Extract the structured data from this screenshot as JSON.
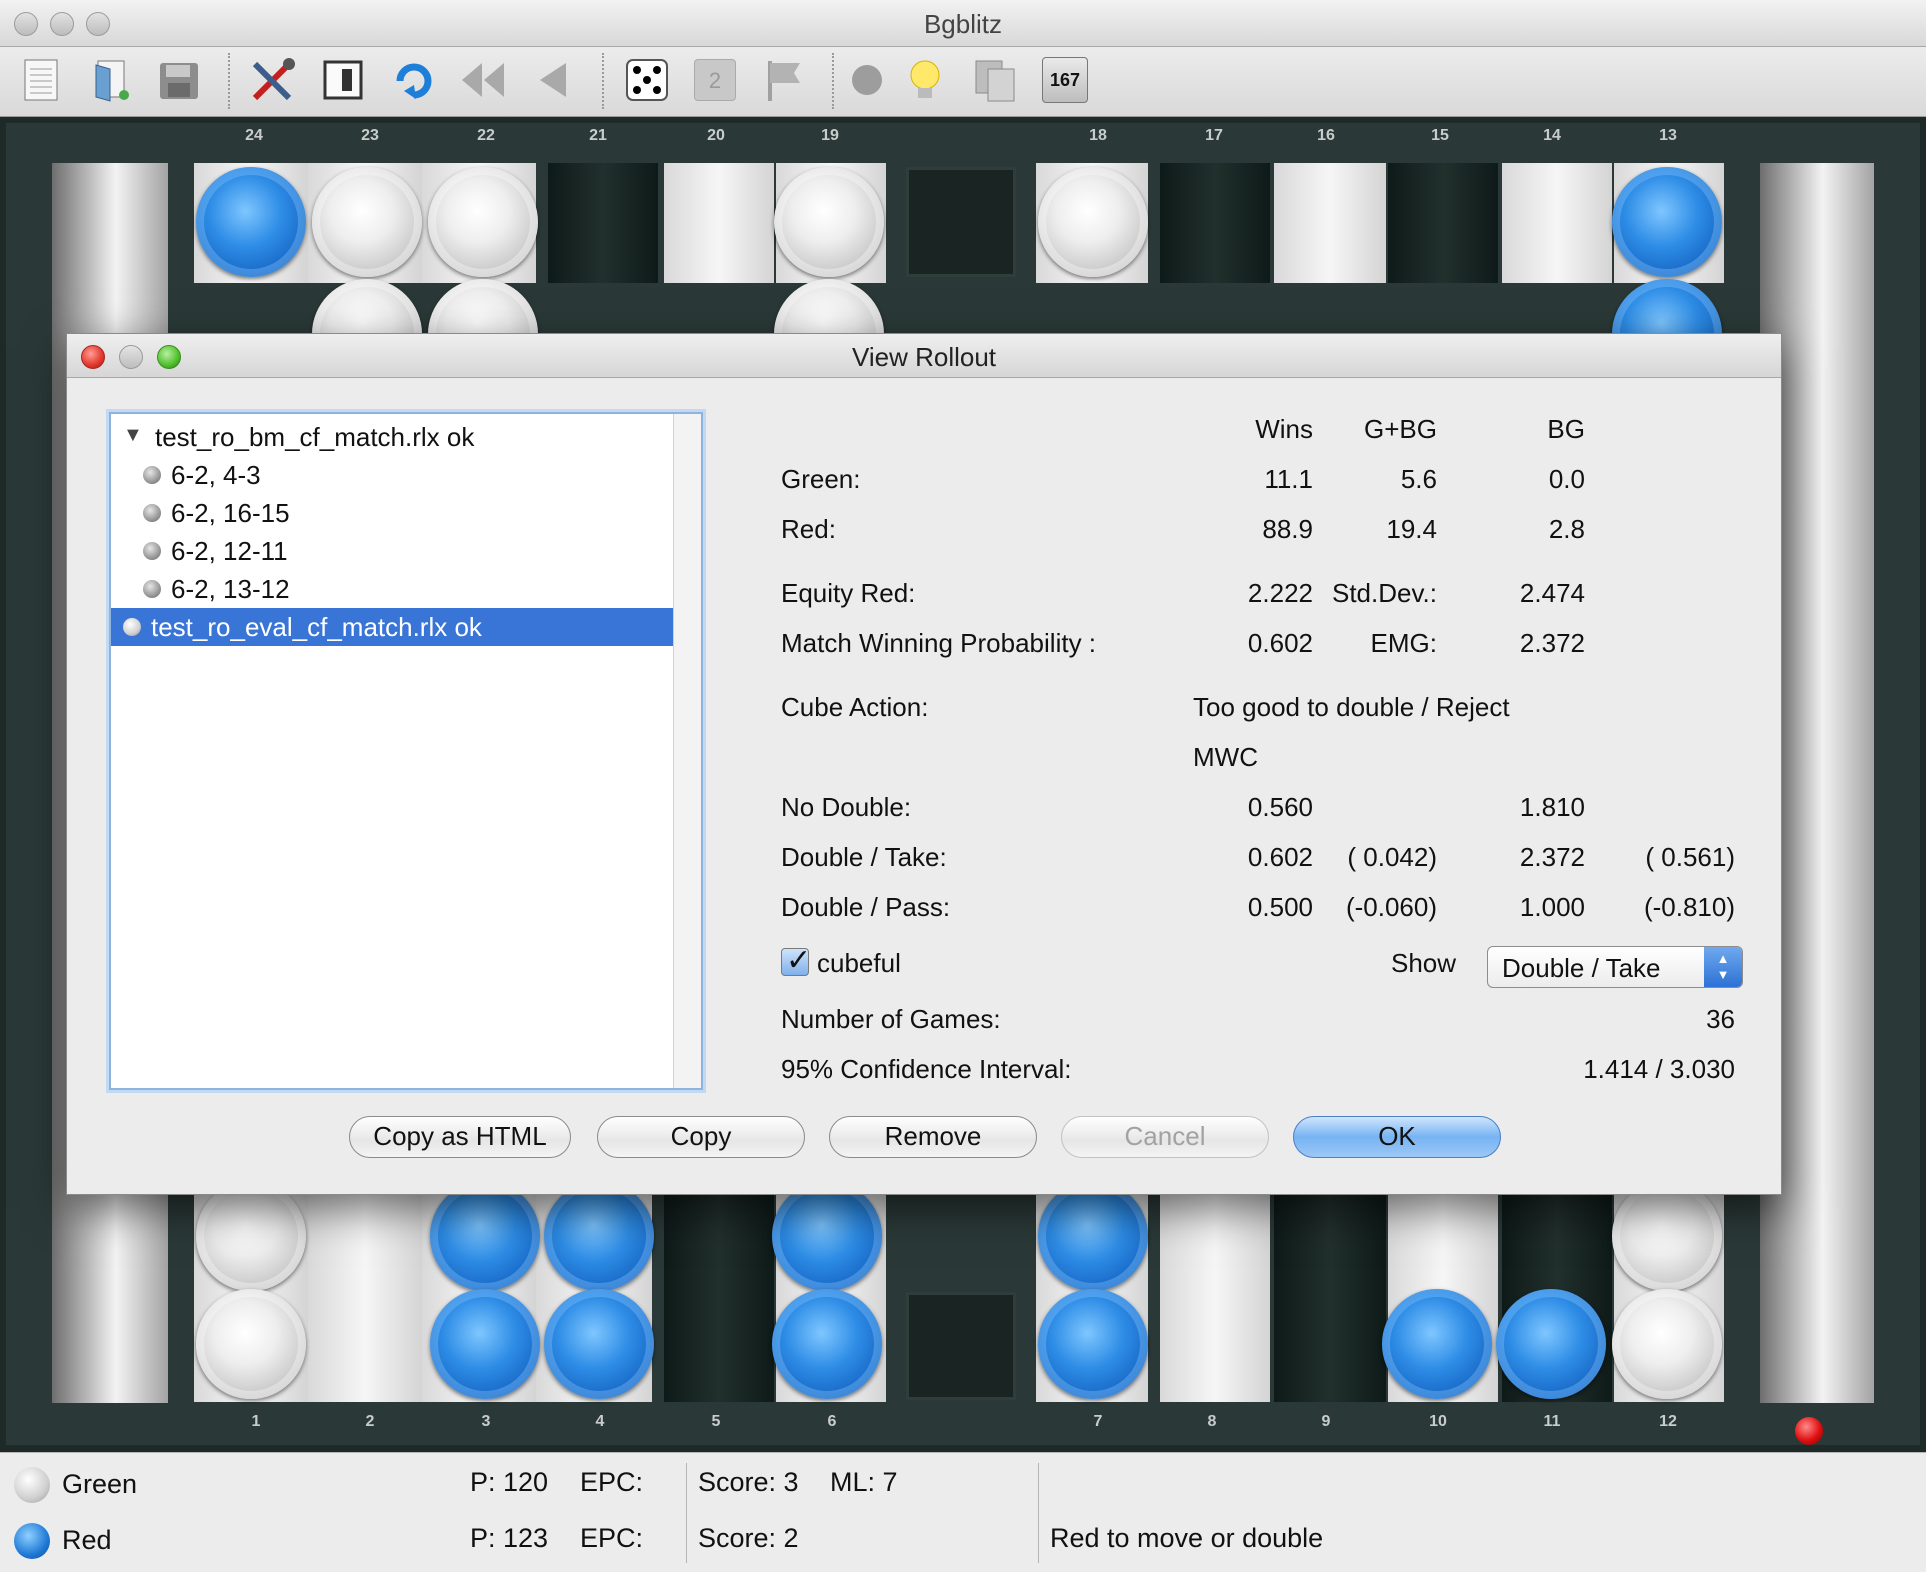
{
  "app": {
    "title": "Bgblitz"
  },
  "toolbar": {
    "buttons": [
      "new-document",
      "open",
      "save",
      "settings-tools",
      "board-setup",
      "rotate",
      "rewind",
      "back",
      "roll-dice",
      "cube",
      "resign-flag",
      "stop",
      "hint-bulb",
      "copy",
      "pip-count"
    ],
    "cube_value": "2",
    "pip_counter": "167"
  },
  "board": {
    "top_numbers": [
      "24",
      "23",
      "22",
      "21",
      "20",
      "19",
      "18",
      "17",
      "16",
      "15",
      "14",
      "13"
    ],
    "bottom_numbers": [
      "1",
      "2",
      "3",
      "4",
      "5",
      "6",
      "7",
      "8",
      "9",
      "10",
      "11",
      "12"
    ],
    "colors": {
      "green_checker": "#e9e9e9",
      "red_checker": "#1e78d8",
      "board": "#1d2a28"
    }
  },
  "dialog": {
    "title": "View Rollout",
    "tree": [
      {
        "label": "test_ro_bm_cf_match.rlx ok",
        "level": 0,
        "expanded": true
      },
      {
        "label": "6-2, 4-3",
        "level": 1
      },
      {
        "label": "6-2, 16-15",
        "level": 1
      },
      {
        "label": "6-2, 12-11",
        "level": 1
      },
      {
        "label": "6-2, 13-12",
        "level": 1
      },
      {
        "label": "test_ro_eval_cf_match.rlx ok",
        "level": 0,
        "selected": true
      }
    ],
    "headers": {
      "wins": "Wins",
      "gbg": "G+BG",
      "bg": "BG"
    },
    "green": {
      "label": "Green:",
      "wins": "11.1",
      "gbg": "5.6",
      "bg": "0.0"
    },
    "red": {
      "label": "Red:",
      "wins": "88.9",
      "gbg": "19.4",
      "bg": "2.8"
    },
    "equity": {
      "label": "Equity Red:",
      "value": "2.222",
      "stddev_label": "Std.Dev.:",
      "stddev": "2.474"
    },
    "mwp": {
      "label": "Match Winning Probability :",
      "value": "0.602",
      "emg_label": "EMG:",
      "emg": "2.372"
    },
    "cube": {
      "label": "Cube Action:",
      "value": "Too good to double / Reject"
    },
    "mwc_label": "MWC",
    "no_double": {
      "label": "No Double:",
      "mwc": "0.560",
      "emg": "1.810"
    },
    "double_take": {
      "label": "Double / Take:",
      "mwc": "0.602",
      "mwc_diff": "( 0.042)",
      "emg": "2.372",
      "emg_diff": "( 0.561)"
    },
    "double_pass": {
      "label": "Double / Pass:",
      "mwc": "0.500",
      "mwc_diff": "(-0.060)",
      "emg": "1.000",
      "emg_diff": "(-0.810)"
    },
    "cubeful": {
      "label": "cubeful",
      "checked": true
    },
    "show": {
      "label": "Show",
      "selected": "Double / Take"
    },
    "games": {
      "label": "Number of Games:",
      "value": "36"
    },
    "confidence": {
      "label": "95% Confidence Interval:",
      "value": "1.414 / 3.030"
    },
    "buttons": {
      "copy_html": "Copy as HTML",
      "copy": "Copy",
      "remove": "Remove",
      "cancel": "Cancel",
      "ok": "OK"
    }
  },
  "status": {
    "green": {
      "name": "Green",
      "pips": "P: 120",
      "epc": "EPC:",
      "score": "Score: 3"
    },
    "red": {
      "name": "Red",
      "pips": "P: 123",
      "epc": "EPC:",
      "score": "Score: 2"
    },
    "match_length": "ML: 7",
    "message": "Red to move or double"
  }
}
